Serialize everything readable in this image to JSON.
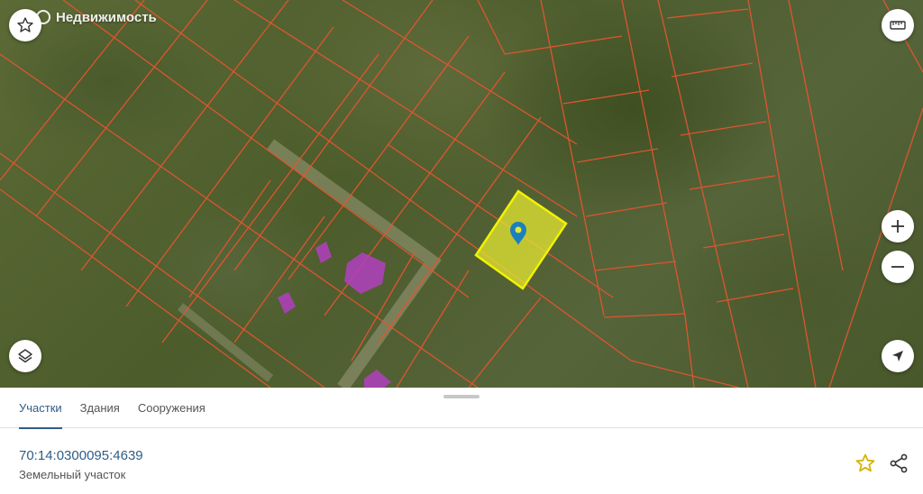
{
  "map": {
    "brand_label": "Недвижимость",
    "parcel_fill_color": "#e5e832",
    "boundary_color": "#e5552f",
    "building_color": "#b23fbf",
    "marker_color": "#1c7fbf",
    "icons": {
      "favorite": "star-outline-icon",
      "ruler": "ruler-icon",
      "zoom_in": "plus-icon",
      "zoom_out": "minus-icon",
      "layers": "layers-icon",
      "locate": "navigation-arrow-icon",
      "marker": "map-pin-icon"
    }
  },
  "tabs": [
    {
      "label": "Участки",
      "active": true
    },
    {
      "label": "Здания",
      "active": false
    },
    {
      "label": "Сооружения",
      "active": false
    }
  ],
  "result": {
    "cadastral_number": "70:14:0300095:4639",
    "object_type": "Земельный участок"
  },
  "actions": {
    "favorite_icon": "star-icon",
    "favorite_color": "#d9b300",
    "share_icon": "share-icon"
  }
}
